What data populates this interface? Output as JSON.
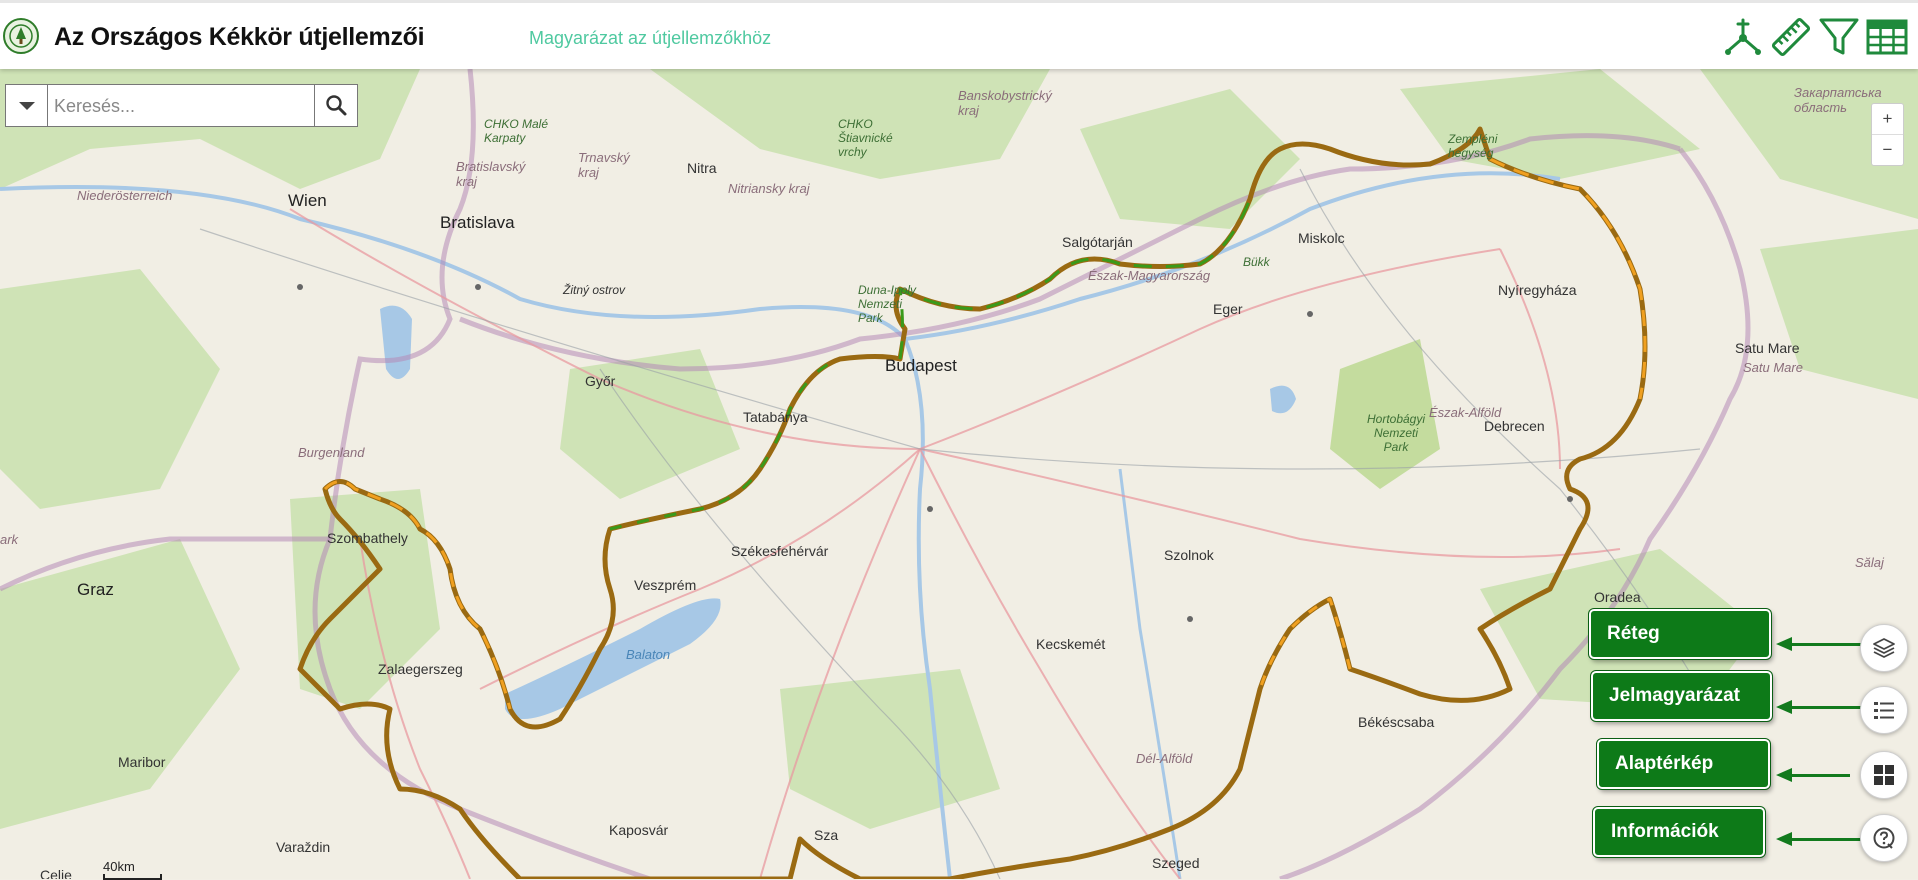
{
  "header": {
    "title": "Az Országos Kékkör útjellemzői",
    "legend_link": "Magyarázat az útjellemzőkhöz",
    "toolbar_icons": [
      "network-icon",
      "ruler-icon",
      "filter-icon",
      "table-icon"
    ]
  },
  "search": {
    "placeholder": "Keresés..."
  },
  "zoom": {
    "in": "+",
    "out": "−"
  },
  "scale": {
    "label": "40km"
  },
  "map": {
    "places": {
      "wien": "Wien",
      "bratislava": "Bratislava",
      "gyor": "Győr",
      "budapest": "Budapest",
      "miskolc": "Miskolc",
      "debrecen": "Debrecen",
      "nyiregyhaza": "Nyíregyháza",
      "szombathely": "Szombathely",
      "zalaegerszeg": "Zalaegerszeg",
      "veszprem": "Veszprém",
      "szekesfehervar": "Székesfehérvár",
      "kecskemet": "Kecskemét",
      "szolnok": "Szolnok",
      "bekescsaba": "Békéscsaba",
      "szeged": "Szeged",
      "kaposvar": "Kaposvár",
      "graz": "Graz",
      "maribor": "Maribor",
      "varazdin": "Varaždin",
      "celje": "Celje",
      "eger": "Eger",
      "salgotarjan": "Salgótarján",
      "tatabanya": "Tatabánya",
      "oradea": "Oradea",
      "satu_mare": "Satu Mare",
      "satu_mare_2": "Satu Mare",
      "nitra": "Nitra",
      "salaj": "Sălaj",
      "niederosterreich": "Niederösterreich",
      "burgenland": "Burgenland",
      "bratislavsky": "Bratislavský kraj",
      "trnavsky": "Trnavský kraj",
      "nitriansky": "Nitriansky kraj",
      "banskobystricky": "Banskobystrický kraj",
      "zakarpatska": "Закарпатська область",
      "chko_male": "CHKO Malé Karpaty",
      "chko_stiavnicke": "CHKO Štiavnické vrchy",
      "zitny": "Žitný ostrov",
      "duna_ipoly": "Duna-Ipoly Nemzeti Park",
      "bukk": "Bükk",
      "eszak_mo": "Észak-Magyarország",
      "eszak_alfold": "Észak-Alföld",
      "del_alfold": "Dél-Alföld",
      "hortobagyi": "Hortobágyi Nemzeti Park",
      "balaton": "Balaton",
      "zemplen": "Zempléni hegység",
      "ark": "ark",
      "sza": "Sza"
    }
  },
  "panels": [
    {
      "label": "Réteg",
      "icon": "layers-icon"
    },
    {
      "label": "Jelmagyarázat",
      "icon": "legend-list-icon"
    },
    {
      "label": "Alaptérkép",
      "icon": "basemap-grid-icon"
    },
    {
      "label": "Információk",
      "icon": "help-icon"
    }
  ],
  "colors": {
    "accent_green": "#0d7a18",
    "link_teal": "#4fc9a0",
    "toolbar_green": "#1f8a3c",
    "trail_brown": "#9a6a12",
    "trail_orange": "#f0a020",
    "trail_green": "#3a9a1a"
  }
}
